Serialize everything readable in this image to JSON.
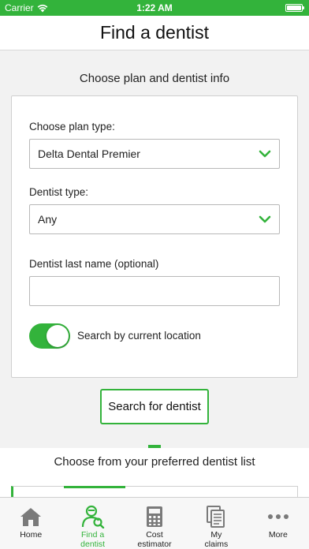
{
  "status_bar": {
    "carrier": "Carrier",
    "time": "1:22 AM",
    "battery_level": 1.0
  },
  "header": {
    "title": "Find a dentist"
  },
  "plan_section": {
    "heading": "Choose plan and dentist info",
    "plan_type": {
      "label": "Choose plan type:",
      "value": "Delta Dental Premier"
    },
    "dentist_type": {
      "label": "Dentist type:",
      "value": "Any"
    },
    "last_name": {
      "label": "Dentist last name (optional)",
      "value": ""
    },
    "location_toggle": {
      "label": "Search by current location",
      "on": true
    },
    "search_button": "Search for dentist"
  },
  "preferred_section": {
    "heading": "Choose from your preferred dentist list"
  },
  "tab_bar": {
    "items": [
      {
        "label": "Home",
        "icon": "home-icon",
        "active": false
      },
      {
        "label": "Find a\ndentist",
        "icon": "dentist-search-icon",
        "active": true
      },
      {
        "label": "Cost\nestimator",
        "icon": "calculator-icon",
        "active": false
      },
      {
        "label": "My\nclaims",
        "icon": "documents-icon",
        "active": false
      },
      {
        "label": "More",
        "icon": "more-dots-icon",
        "active": false
      }
    ]
  },
  "colors": {
    "accent": "#33b33b",
    "background": "#f2f2f2",
    "icon_gray": "#7a7a7a"
  }
}
